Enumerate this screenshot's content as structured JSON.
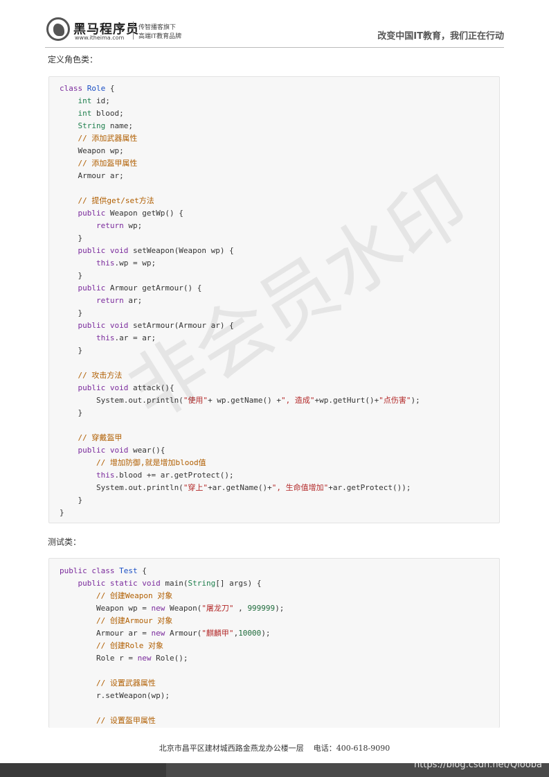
{
  "header": {
    "brand_name": "黑马程序员",
    "brand_url": "www.itheima.com",
    "brand_sub1": "传智播客旗下",
    "brand_sub2": "高端IT教育品牌",
    "slogan": "改变中国IT教育，我们正在行动"
  },
  "section1": {
    "label": "定义角色类："
  },
  "code1": [
    [
      [
        "class ",
        "kw"
      ],
      [
        "Role",
        "cls"
      ],
      [
        " {",
        ""
      ]
    ],
    [
      [
        "    ",
        ""
      ],
      [
        "int",
        "ty"
      ],
      [
        " id;",
        ""
      ]
    ],
    [
      [
        "    ",
        ""
      ],
      [
        "int",
        "ty"
      ],
      [
        " blood;",
        ""
      ]
    ],
    [
      [
        "    ",
        ""
      ],
      [
        "String",
        "ty"
      ],
      [
        " name;",
        ""
      ]
    ],
    [
      [
        "    ",
        ""
      ],
      [
        "// 添加武器属性",
        "cm"
      ]
    ],
    [
      [
        "    Weapon wp;",
        ""
      ]
    ],
    [
      [
        "    ",
        ""
      ],
      [
        "// 添加盔甲属性",
        "cm"
      ]
    ],
    [
      [
        "    Armour ar;",
        ""
      ]
    ],
    [
      [
        "",
        ""
      ]
    ],
    [
      [
        "    ",
        ""
      ],
      [
        "// 提供get/set方法",
        "cm"
      ]
    ],
    [
      [
        "    ",
        ""
      ],
      [
        "public",
        "kw"
      ],
      [
        " Weapon getWp() {",
        ""
      ]
    ],
    [
      [
        "        ",
        ""
      ],
      [
        "return",
        "kw"
      ],
      [
        " wp;",
        ""
      ]
    ],
    [
      [
        "    }",
        ""
      ]
    ],
    [
      [
        "    ",
        ""
      ],
      [
        "public",
        "kw"
      ],
      [
        " ",
        ""
      ],
      [
        "void",
        "kw"
      ],
      [
        " setWeapon(Weapon wp) {",
        ""
      ]
    ],
    [
      [
        "        ",
        ""
      ],
      [
        "this",
        "kw"
      ],
      [
        ".wp = wp;",
        ""
      ]
    ],
    [
      [
        "    }",
        ""
      ]
    ],
    [
      [
        "    ",
        ""
      ],
      [
        "public",
        "kw"
      ],
      [
        " Armour getArmour() {",
        ""
      ]
    ],
    [
      [
        "        ",
        ""
      ],
      [
        "return",
        "kw"
      ],
      [
        " ar;",
        ""
      ]
    ],
    [
      [
        "    }",
        ""
      ]
    ],
    [
      [
        "    ",
        ""
      ],
      [
        "public",
        "kw"
      ],
      [
        " ",
        ""
      ],
      [
        "void",
        "kw"
      ],
      [
        " setArmour(Armour ar) {",
        ""
      ]
    ],
    [
      [
        "        ",
        ""
      ],
      [
        "this",
        "kw"
      ],
      [
        ".ar = ar;",
        ""
      ]
    ],
    [
      [
        "    }",
        ""
      ]
    ],
    [
      [
        "",
        ""
      ]
    ],
    [
      [
        "    ",
        ""
      ],
      [
        "// 攻击方法",
        "cm"
      ]
    ],
    [
      [
        "    ",
        ""
      ],
      [
        "public",
        "kw"
      ],
      [
        " ",
        ""
      ],
      [
        "void",
        "kw"
      ],
      [
        " attack(){",
        ""
      ]
    ],
    [
      [
        "        System.out.println(",
        ""
      ],
      [
        "\"使用\"",
        "str"
      ],
      [
        "+ wp.getName() +",
        ""
      ],
      [
        "\", 造成\"",
        "str"
      ],
      [
        "+wp.getHurt()+",
        ""
      ],
      [
        "\"点伤害\"",
        "str"
      ],
      [
        ");",
        ""
      ]
    ],
    [
      [
        "    }",
        ""
      ]
    ],
    [
      [
        "",
        ""
      ]
    ],
    [
      [
        "    ",
        ""
      ],
      [
        "// 穿戴盔甲",
        "cm"
      ]
    ],
    [
      [
        "    ",
        ""
      ],
      [
        "public",
        "kw"
      ],
      [
        " ",
        ""
      ],
      [
        "void",
        "kw"
      ],
      [
        " wear(){",
        ""
      ]
    ],
    [
      [
        "        ",
        ""
      ],
      [
        "// 增加防御,就是增加blood值",
        "cm"
      ]
    ],
    [
      [
        "        ",
        ""
      ],
      [
        "this",
        "kw"
      ],
      [
        ".blood += ar.getProtect();",
        ""
      ]
    ],
    [
      [
        "        System.out.println(",
        ""
      ],
      [
        "\"穿上\"",
        "str"
      ],
      [
        "+ar.getName()+",
        ""
      ],
      [
        "\", 生命值增加\"",
        "str"
      ],
      [
        "+ar.getProtect());",
        ""
      ]
    ],
    [
      [
        "    }",
        ""
      ]
    ],
    [
      [
        "}",
        ""
      ]
    ]
  ],
  "section2": {
    "label": "测试类："
  },
  "code2": [
    [
      [
        "public",
        "kw"
      ],
      [
        " ",
        ""
      ],
      [
        "class",
        "kw"
      ],
      [
        " ",
        ""
      ],
      [
        "Test",
        "cls"
      ],
      [
        " {",
        ""
      ]
    ],
    [
      [
        "    ",
        ""
      ],
      [
        "public",
        "kw"
      ],
      [
        " ",
        ""
      ],
      [
        "static",
        "kw"
      ],
      [
        " ",
        ""
      ],
      [
        "void",
        "kw"
      ],
      [
        " main(",
        ""
      ],
      [
        "String",
        "ty"
      ],
      [
        "[] args) {",
        ""
      ]
    ],
    [
      [
        "        ",
        ""
      ],
      [
        "// 创建Weapon 对象",
        "cm"
      ]
    ],
    [
      [
        "        Weapon wp = ",
        ""
      ],
      [
        "new",
        "kw"
      ],
      [
        " Weapon(",
        ""
      ],
      [
        "\"屠龙刀\"",
        "str"
      ],
      [
        " , ",
        ""
      ],
      [
        "999999",
        "num"
      ],
      [
        ");",
        ""
      ]
    ],
    [
      [
        "        ",
        ""
      ],
      [
        "// 创建Armour 对象",
        "cm"
      ]
    ],
    [
      [
        "        Armour ar = ",
        ""
      ],
      [
        "new",
        "kw"
      ],
      [
        " Armour(",
        ""
      ],
      [
        "\"麒麟甲\"",
        "str"
      ],
      [
        ",",
        ""
      ],
      [
        "10000",
        "num"
      ],
      [
        ");",
        ""
      ]
    ],
    [
      [
        "        ",
        ""
      ],
      [
        "// 创建Role 对象",
        "cm"
      ]
    ],
    [
      [
        "        Role r = ",
        ""
      ],
      [
        "new",
        "kw"
      ],
      [
        " Role();",
        ""
      ]
    ],
    [
      [
        "",
        ""
      ]
    ],
    [
      [
        "        ",
        ""
      ],
      [
        "// 设置武器属性",
        "cm"
      ]
    ],
    [
      [
        "        r.setWeapon(wp);",
        ""
      ]
    ],
    [
      [
        "",
        ""
      ]
    ],
    [
      [
        "        ",
        ""
      ],
      [
        "// 设置盔甲属性",
        "cm"
      ]
    ]
  ],
  "footer": {
    "address": "北京市昌平区建材城西路金燕龙办公楼一层    电话：400-618-9090",
    "csdn": "https://blog.csdn.net/Qiooba"
  },
  "watermark": "非会员水印"
}
